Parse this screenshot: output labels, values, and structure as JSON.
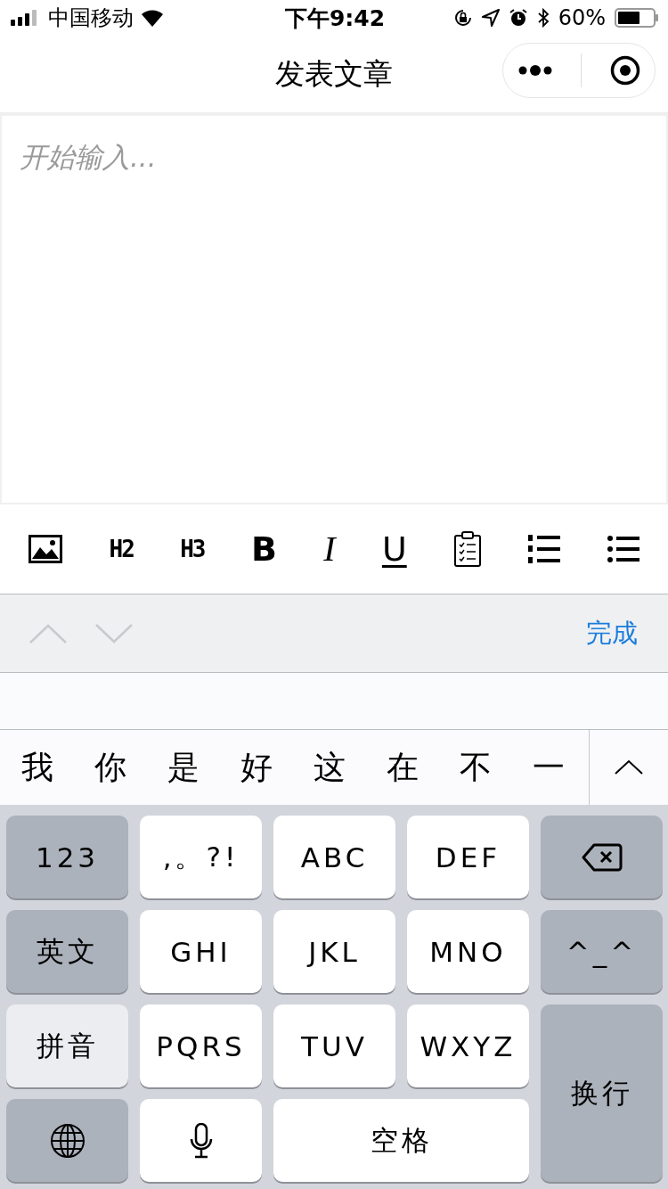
{
  "status_bar": {
    "carrier": "中国移动",
    "time": "下午9:42",
    "battery": "60%"
  },
  "nav": {
    "title": "发表文章"
  },
  "editor": {
    "placeholder": "开始输入..."
  },
  "toolbar": [
    {
      "kind": "image"
    },
    {
      "kind": "heading",
      "label": "H2"
    },
    {
      "kind": "heading",
      "label": "H3"
    },
    {
      "kind": "bold",
      "label": "B"
    },
    {
      "kind": "italic",
      "label": "I"
    },
    {
      "kind": "underline",
      "label": "U"
    },
    {
      "kind": "checklist"
    },
    {
      "kind": "ordered_list"
    },
    {
      "kind": "bullet_list"
    }
  ],
  "accessory_bar": {
    "arrows": [
      {
        "kind": "up",
        "disabled": true
      },
      {
        "kind": "down",
        "disabled": true
      }
    ],
    "done": "完成"
  },
  "candidates": [
    "我",
    "你",
    "是",
    "好",
    "这",
    "在",
    "不",
    "一"
  ],
  "keyboard": [
    {
      "kind": "text",
      "function_key": true,
      "active": false,
      "label": "123"
    },
    {
      "kind": "text",
      "function_key": false,
      "active": false,
      "label": ",。?!"
    },
    {
      "kind": "text",
      "function_key": false,
      "active": false,
      "label": "ABC"
    },
    {
      "kind": "text",
      "function_key": false,
      "active": false,
      "label": "DEF"
    },
    {
      "kind": "delete",
      "function_key": true,
      "active": false
    },
    {
      "kind": "text",
      "function_key": true,
      "active": false,
      "label": "英文"
    },
    {
      "kind": "text",
      "function_key": false,
      "active": false,
      "label": "GHI"
    },
    {
      "kind": "text",
      "function_key": false,
      "active": false,
      "label": "JKL"
    },
    {
      "kind": "text",
      "function_key": false,
      "active": false,
      "label": "MNO"
    },
    {
      "kind": "text",
      "function_key": true,
      "active": false,
      "label": "^_^"
    },
    {
      "kind": "text",
      "function_key": true,
      "active": true,
      "label": "拼音"
    },
    {
      "kind": "text",
      "function_key": false,
      "active": false,
      "label": "PQRS"
    },
    {
      "kind": "text",
      "function_key": false,
      "active": false,
      "label": "TUV"
    },
    {
      "kind": "text",
      "function_key": false,
      "active": false,
      "label": "WXYZ"
    },
    {
      "kind": "return",
      "function_key": true,
      "active": false,
      "label": "换行"
    },
    {
      "kind": "globe",
      "function_key": true,
      "active": false
    },
    {
      "kind": "mic",
      "function_key": false,
      "active": false
    },
    {
      "kind": "space",
      "function_key": false,
      "active": false,
      "label": "空格"
    }
  ]
}
